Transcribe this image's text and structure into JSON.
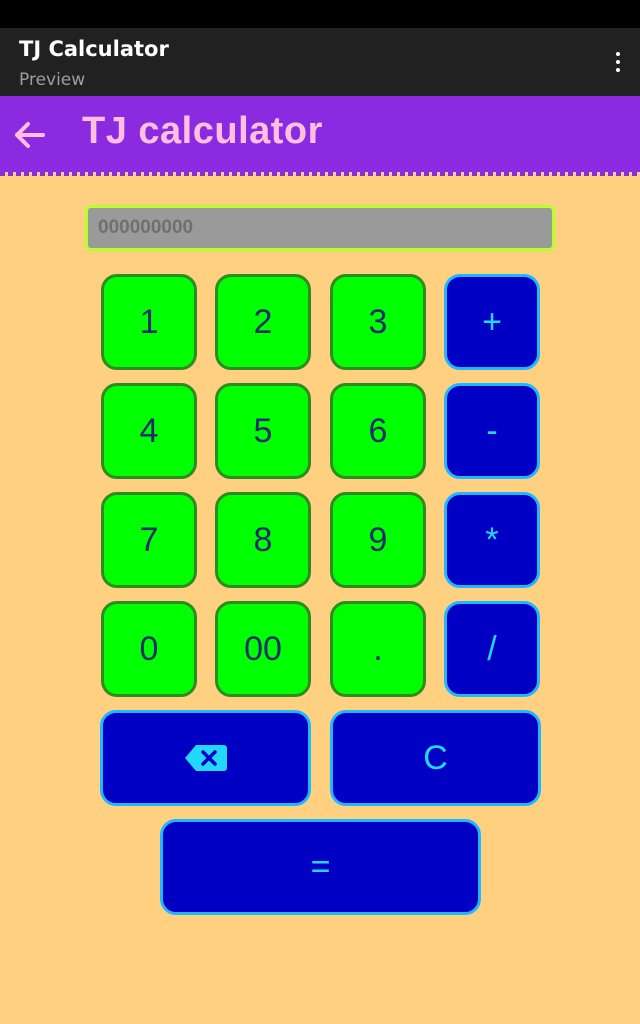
{
  "preview_header": {
    "title": "TJ Calculator",
    "subtitle": "Preview"
  },
  "app_bar": {
    "title": "TJ calculator",
    "back_icon": "arrow-back-icon"
  },
  "display": {
    "placeholder": "000000000",
    "value": ""
  },
  "keys": {
    "k1": "1",
    "k2": "2",
    "k3": "3",
    "plus": "+",
    "k4": "4",
    "k5": "5",
    "k6": "6",
    "minus": "-",
    "k7": "7",
    "k8": "8",
    "k9": "9",
    "multiply": "*",
    "k0": "0",
    "k00": "00",
    "dot": ".",
    "divide": "/",
    "backspace_icon": "backspace-icon",
    "clear": "C",
    "equals": "="
  },
  "colors": {
    "background": "#ffd07f",
    "app_bar": "#8a2be2",
    "app_title": "#ffc0e0",
    "number_key": "#00ff00",
    "number_key_border": "#2e8b22",
    "number_key_text": "#1c2d6b",
    "operator_key": "#0000c4",
    "operator_key_border": "#1fb7ff",
    "operator_key_text": "#23d7ff",
    "display_bg": "#9a9a9a",
    "display_border": "#b7ff2a"
  }
}
